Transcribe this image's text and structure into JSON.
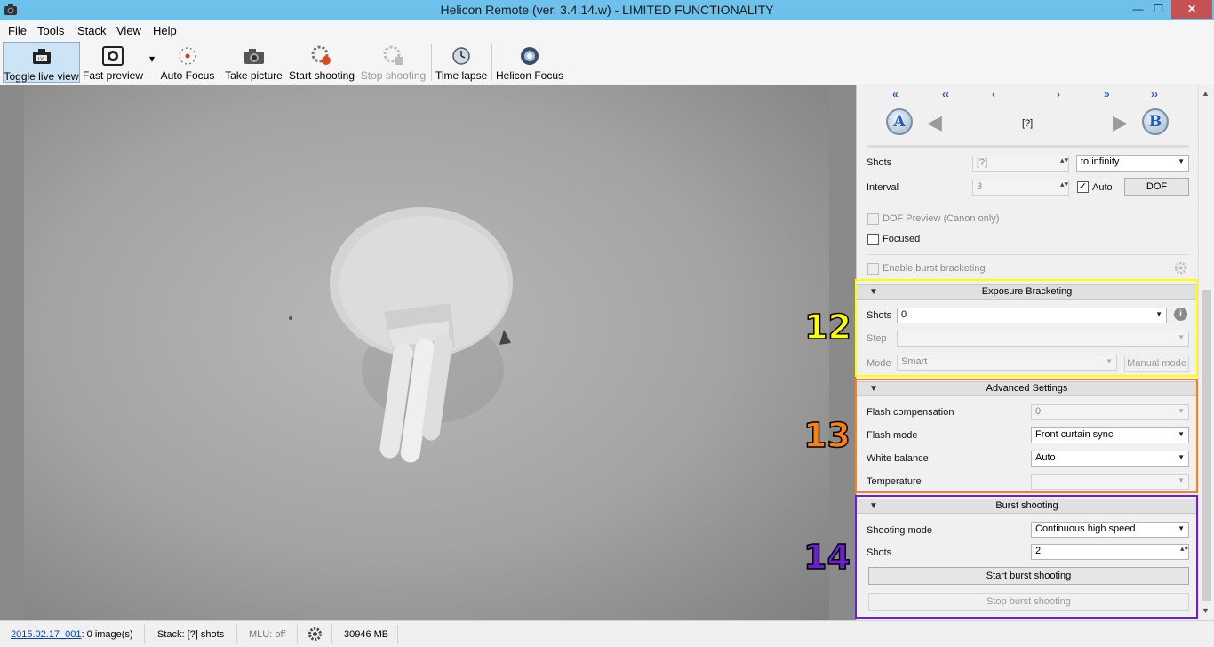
{
  "window": {
    "title": "Helicon Remote (ver. 3.4.14.w) - LIMITED FUNCTIONALITY",
    "minimize": "—",
    "maximize": "❐",
    "close": "✕"
  },
  "menu": [
    "File",
    "Tools",
    "Stack",
    "View",
    "Help"
  ],
  "toolbar": {
    "toggle_live_view": "Toggle live view",
    "fast_preview": "Fast preview",
    "auto_focus": "Auto Focus",
    "take_picture": "Take picture",
    "start_shooting": "Start shooting",
    "stop_shooting": "Stop shooting",
    "time_lapse": "Time lapse",
    "helicon_focus": "Helicon Focus",
    "dropdown_arrow": "▾"
  },
  "focus_nav": {
    "arrows": [
      "«",
      "‹‹",
      "‹",
      "›",
      "»",
      "››"
    ],
    "a_label": "A",
    "b_label": "B",
    "position": "[?]",
    "prev_big": "◀",
    "next_big": "▶"
  },
  "shots": {
    "label": "Shots",
    "value": "[?]",
    "mode": "to infinity"
  },
  "interval": {
    "label": "Interval",
    "value": "3",
    "auto_label": "Auto",
    "auto_checked": "✓",
    "dof_button": "DOF"
  },
  "options": {
    "dof_preview": "DOF Preview (Canon only)",
    "focused": "Focused",
    "enable_burst": "Enable burst bracketing"
  },
  "exposure": {
    "header": "Exposure Bracketing",
    "shots_label": "Shots",
    "shots_value": "0",
    "step_label": "Step",
    "step_value": "",
    "mode_label": "Mode",
    "mode_value": "Smart",
    "manual_mode": "Manual mode",
    "info_icon": "i"
  },
  "advanced": {
    "header": "Advanced Settings",
    "flash_comp_label": "Flash compensation",
    "flash_comp_value": "0",
    "flash_mode_label": "Flash mode",
    "flash_mode_value": "Front curtain sync",
    "wb_label": "White balance",
    "wb_value": "Auto",
    "temp_label": "Temperature",
    "temp_value": ""
  },
  "burst": {
    "header": "Burst shooting",
    "mode_label": "Shooting mode",
    "mode_value": "Continuous high speed",
    "shots_label": "Shots",
    "shots_value": "2",
    "start": "Start burst shooting",
    "stop": "Stop burst shooting"
  },
  "callouts": {
    "n12": "12",
    "n13": "13",
    "n14": "14",
    "color12": "#ffff00",
    "color13": "#ff7f10",
    "color14": "#6a1fd0"
  },
  "status": {
    "session_link": "2015.02.17_001",
    "images": ": 0 image(s)",
    "stack": "Stack: [?] shots",
    "mlu": "MLU: off",
    "disk": "30946 MB"
  }
}
